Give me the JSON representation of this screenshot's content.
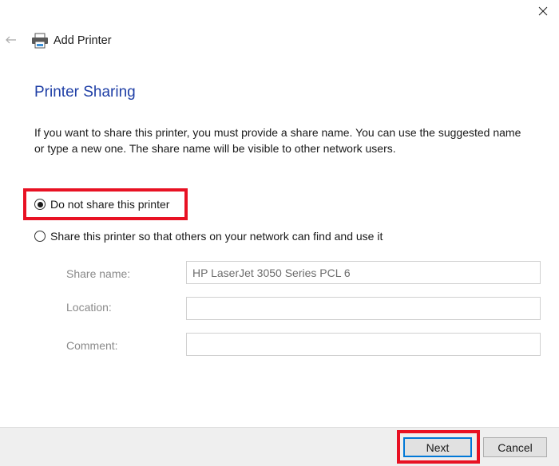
{
  "window": {
    "title": "Add Printer",
    "close_label": "Close",
    "back_label": "Back"
  },
  "page": {
    "heading": "Printer Sharing",
    "description": "If you want to share this printer, you must provide a share name. You can use the suggested name or type a new one. The share name will be visible to other network users."
  },
  "options": [
    {
      "label": "Do not share this printer",
      "checked": true
    },
    {
      "label": "Share this printer so that others on your network can find and use it",
      "checked": false
    }
  ],
  "fields": {
    "share_name": {
      "label": "Share name:",
      "value": "HP LaserJet 3050 Series PCL 6"
    },
    "location": {
      "label": "Location:",
      "value": ""
    },
    "comment": {
      "label": "Comment:",
      "value": ""
    }
  },
  "footer": {
    "next_label": "Next",
    "cancel_label": "Cancel"
  },
  "colors": {
    "heading": "#1f3fa6",
    "highlight": "#e81123",
    "focus": "#0078d7"
  }
}
